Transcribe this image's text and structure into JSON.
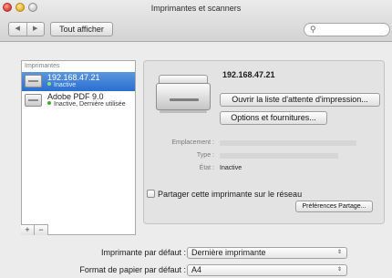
{
  "window": {
    "title": "Imprimantes et scanners"
  },
  "toolbar": {
    "back_glyph": "◀",
    "forward_glyph": "▶",
    "show_all_label": "Tout afficher",
    "search_placeholder": ""
  },
  "printers": {
    "header": "Imprimantes",
    "items": [
      {
        "name": "192.168.47.21",
        "status": "Inactive",
        "selected": true
      },
      {
        "name": "Adobe PDF 9.0",
        "status": "Inactive, Dernière utilisée",
        "selected": false
      }
    ],
    "add_label": "+",
    "remove_label": "−"
  },
  "detail": {
    "device_name": "192.168.47.21",
    "open_queue_label": "Ouvrir la liste d'attente d'impression...",
    "options_label": "Options et fournitures...",
    "location_label": "Emplacement :",
    "type_label": "Type :",
    "state_label": "État :",
    "state_value": "Inactive",
    "share_label": "Partager cette imprimante sur le réseau",
    "share_prefs_label": "Préférences Partage..."
  },
  "defaults": {
    "default_printer_label": "Imprimante par défaut :",
    "default_printer_value": "Dernière imprimante",
    "paper_label": "Format de papier par défaut :",
    "paper_value": "A4"
  }
}
